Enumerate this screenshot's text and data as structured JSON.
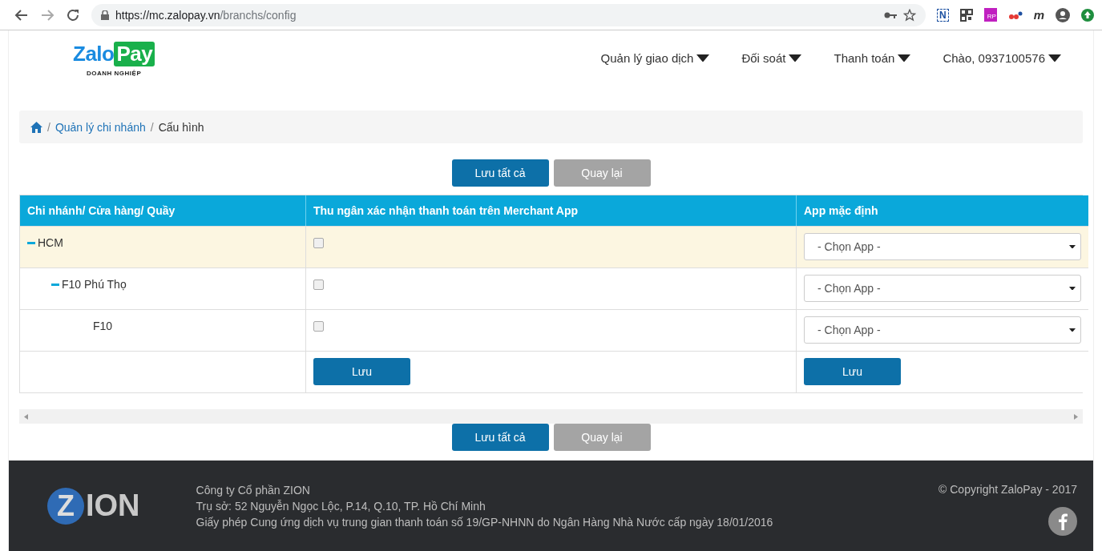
{
  "browser": {
    "url_host": "https://mc.zalopay.vn",
    "url_path": "/branchs/config",
    "extensions": [
      {
        "kind": "text",
        "label": "N"
      },
      {
        "kind": "qr"
      },
      {
        "kind": "badge",
        "label": "RP"
      },
      {
        "kind": "dots"
      },
      {
        "kind": "text",
        "label": "m"
      }
    ]
  },
  "header": {
    "logo": {
      "left": "Zalo",
      "right": "Pay",
      "subtitle": "DOANH NGHIỆP"
    },
    "nav": [
      {
        "label": "Quản lý giao dịch"
      },
      {
        "label": "Đối soát"
      },
      {
        "label": "Thanh toán"
      },
      {
        "label": "Chào, 0937100576"
      }
    ]
  },
  "breadcrumb": {
    "separator": "/",
    "items": [
      {
        "label": "Quản lý chi nhánh",
        "link": true
      },
      {
        "label": "Cấu hình",
        "link": false
      }
    ]
  },
  "actions_top": {
    "primary": "Lưu tất cả",
    "secondary": {
      "label": "Quay lại",
      "disabled": true
    }
  },
  "table": {
    "columns": [
      "Chi nhánh/ Cửa hàng/ Quầy",
      "Thu ngân xác nhận thanh toán trên Merchant App",
      "App mặc định"
    ],
    "rows": [
      {
        "name": "HCM",
        "expanded": true,
        "selected": true,
        "checked": false,
        "app": "- Chọn App -",
        "children": [
          {
            "name": "F10 Phú Thọ",
            "expanded": true,
            "selected": false,
            "checked": false,
            "app": "- Chọn App -",
            "children": [
              {
                "name": "F10",
                "selected": false,
                "checked": false,
                "app": "- Chọn App -"
              }
            ]
          }
        ]
      }
    ],
    "save_row": {
      "checkbox_button": "Lưu",
      "app_button": "Lưu"
    }
  },
  "actions_bottom": {
    "primary": "Lưu tất cả",
    "secondary": {
      "label": "Quay lại",
      "disabled": true
    }
  },
  "footer": {
    "logo": {
      "mark": "Z",
      "rest": "ION"
    },
    "lines": [
      "Công ty Cổ phần ZION",
      "Trụ sở: 52 Nguyễn Ngọc Lộc, P.14, Q.10, TP. Hồ Chí Minh",
      "Giấy phép Cung ứng dịch vụ trung gian thanh toán số 19/GP-NHNN do Ngân Hàng Nhà Nước cấp ngày 18/01/2016"
    ],
    "copyright": "© Copyright ZaloPay - 2017"
  }
}
